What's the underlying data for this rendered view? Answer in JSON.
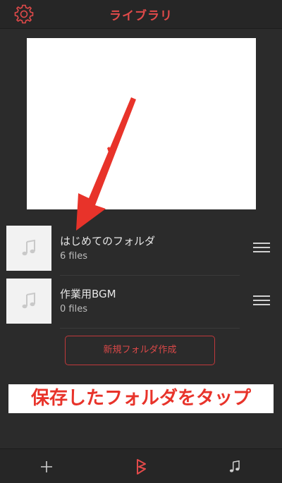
{
  "header": {
    "title": "ライブラリ",
    "settings_icon": "gear-icon"
  },
  "folders": [
    {
      "name": "はじめてのフォルダ",
      "count": "6 files",
      "icon": "music-note-icon"
    },
    {
      "name": "作業用BGM",
      "count": "0 files",
      "icon": "music-note-icon"
    }
  ],
  "actions": {
    "new_folder_label": "新規フォルダ作成"
  },
  "annotation": {
    "text": "保存したフォルダをタップ"
  },
  "tabbar": {
    "items": [
      {
        "icon": "plus-icon"
      },
      {
        "icon": "logo-b-icon",
        "active": true
      },
      {
        "icon": "music-note-icon"
      }
    ]
  },
  "colors": {
    "accent": "#e24a4a",
    "background": "#2b2b2b",
    "annotation_text": "#e8332a"
  }
}
